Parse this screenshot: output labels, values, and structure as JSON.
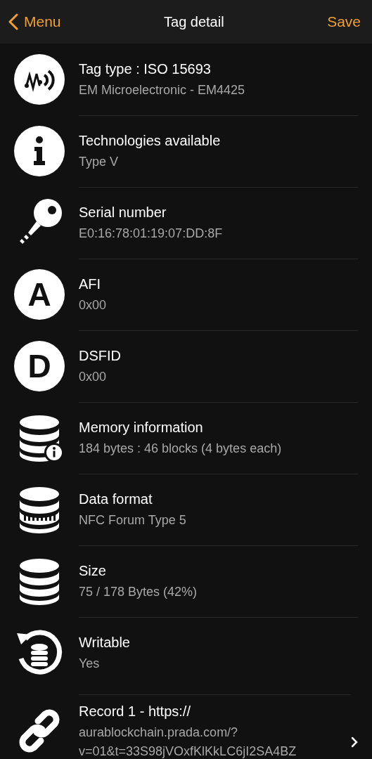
{
  "nav": {
    "back": "Menu",
    "title": "Tag detail",
    "action": "Save"
  },
  "rows": [
    {
      "kind": "waves",
      "title": "Tag type : ISO 15693",
      "details": [
        "EM Microelectronic - EM4425"
      ],
      "disclosure": false
    },
    {
      "kind": "info",
      "title": "Technologies available",
      "details": [
        "Type V"
      ],
      "disclosure": false
    },
    {
      "kind": "key",
      "title": "Serial number",
      "details": [
        "E0:16:78:01:19:07:DD:8F"
      ],
      "disclosure": false
    },
    {
      "kind": "letter",
      "letter": "A",
      "title": "AFI",
      "details": [
        "0x00"
      ],
      "disclosure": false
    },
    {
      "kind": "letter",
      "letter": "D",
      "title": "DSFID",
      "details": [
        "0x00"
      ],
      "disclosure": false
    },
    {
      "kind": "db-info",
      "title": "Memory information",
      "details": [
        "184 bytes : 46 blocks (4 bytes each)"
      ],
      "disclosure": false
    },
    {
      "kind": "db-format",
      "title": "Data format",
      "details": [
        "NFC Forum Type 5"
      ],
      "disclosure": false
    },
    {
      "kind": "db",
      "title": "Size",
      "details": [
        "75 / 178 Bytes (42%)"
      ],
      "disclosure": false
    },
    {
      "kind": "db-refresh",
      "title": "Writable",
      "details": [
        "Yes"
      ],
      "disclosure": false
    },
    {
      "kind": "link",
      "title": "Record 1 - https://",
      "details": [
        "aurablockchain.prada.com/?",
        "v=01&t=33S98jVOxfKlKkLC6jI2SA4BZ"
      ],
      "disclosure": true
    }
  ]
}
